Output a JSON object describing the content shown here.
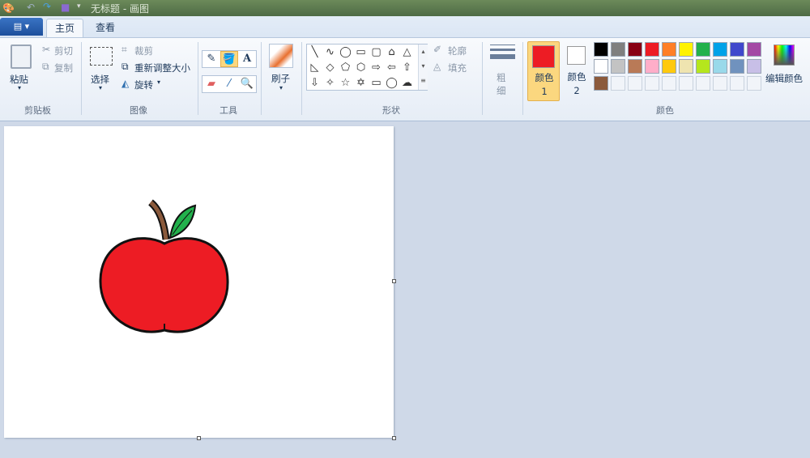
{
  "window": {
    "title": "无标题 - 画图"
  },
  "tabs": [
    {
      "label": "主页",
      "active": true
    },
    {
      "label": "查看",
      "active": false
    }
  ],
  "clipboard": {
    "group": "剪贴板",
    "paste": "粘贴",
    "cut": "剪切",
    "copy": "复制"
  },
  "image": {
    "group": "图像",
    "select": "选择",
    "crop": "裁剪",
    "resize": "重新调整大小",
    "rotate": "旋转"
  },
  "tools": {
    "group": "工具",
    "items": [
      "pencil-icon",
      "fill-icon",
      "text-icon",
      "eraser-icon",
      "color-picker-icon",
      "magnifier-icon"
    ],
    "selected": "fill-icon"
  },
  "brushes": {
    "label": "刷子"
  },
  "shapes": {
    "group": "形状",
    "outline": "轮廓",
    "fill": "填充",
    "glyphs": [
      "╲",
      "∿",
      "◯",
      "▭",
      "▢",
      "⌂",
      "△",
      "◺",
      "◇",
      "⬠",
      "⬡",
      "⇨",
      "⇦",
      "⇧",
      "⇩",
      "✧",
      "☆",
      "✡",
      "▭",
      "◯",
      "☁"
    ]
  },
  "size": {
    "label": "粗细"
  },
  "colors": {
    "group": "颜色",
    "color1": "颜色 1",
    "color2": "颜色 2",
    "color1_value": "#ed1c24",
    "color2_value": "#ffffff",
    "edit": "编辑颜色",
    "palette": [
      "#000000",
      "#7f7f7f",
      "#880015",
      "#ed1c24",
      "#ff7f27",
      "#fff200",
      "#22b14c",
      "#00a2e8",
      "#3f48cc",
      "#a349a4",
      "#ffffff",
      "#c3c3c3",
      "#b97a57",
      "#ffaec9",
      "#ffc90e",
      "#efe4b0",
      "#b5e61d",
      "#99d9ea",
      "#7092be",
      "#c8bfe7",
      "#8b5a3c",
      null,
      null,
      null,
      null,
      null,
      null,
      null,
      null,
      null
    ]
  }
}
